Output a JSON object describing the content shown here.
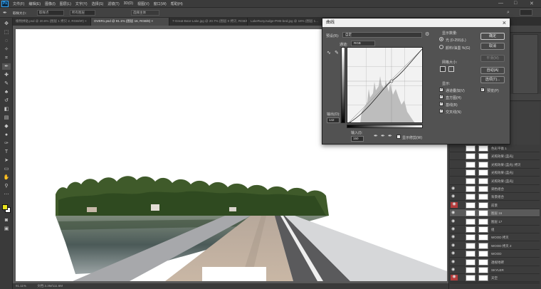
{
  "app": {
    "logo": "Ps"
  },
  "menu": [
    "文件(F)",
    "编辑(E)",
    "图像(I)",
    "图层(L)",
    "文字(Y)",
    "选择(S)",
    "滤镜(T)",
    "3D(D)",
    "视图(V)",
    "窗口(W)",
    "帮助(H)"
  ],
  "options_bar": {
    "tool_label": "取样大小:",
    "sample": "取样点",
    "all_layers": "所有图层",
    "select_subject": "选择主体"
  },
  "tabs": [
    {
      "label": "植物拼贴.psd @ 20.6% (图层 1 拷贝 2, RGB/8#) ×",
      "active": false
    },
    {
      "label": "OVER1.psd @ 91.1% (图层 16, RGB/8) ×",
      "active": true
    },
    {
      "label": "7-Great-Bear-Lake.jpg @ 20.7% (图层 0 拷贝, RGB/8) ×",
      "active": false
    },
    {
      "label": "LakeRunyJudge-PHB-bed.jpg @ 18% (图层 1...",
      "active": false
    }
  ],
  "status": {
    "zoom": "91.11%",
    "doc": "文档:3.3M/111.6M"
  },
  "curves": {
    "title": "曲线",
    "preset_label": "预设(R):",
    "preset_value": "自定",
    "channel_label": "通道:",
    "channel_value": "RGB",
    "output_label": "输出(O):",
    "output_value": "142",
    "input_label": "输入(I):",
    "input_value": "150",
    "show_clipping": "显示修剪(W)",
    "display_amount": "显示数量:",
    "light": "光 (0-255)(L)",
    "pigment": "颜料/油墨 %(G)",
    "grid_size": "网格大小:",
    "show": "显示:",
    "options": [
      "通道叠加(V)",
      "直方图(H)",
      "基线(B)",
      "交叉线(N)"
    ],
    "buttons": {
      "ok": "确定",
      "cancel": "取消",
      "smooth": "平滑(M)",
      "auto": "自动(A)",
      "options": "选项(T)..."
    },
    "preview": "预览(P)"
  },
  "layers": [
    {
      "name": "色彩平衡 1",
      "eye": false,
      "red": false,
      "sel": false
    },
    {
      "name": "光照效果 (蓝光)",
      "eye": false,
      "red": false,
      "sel": false
    },
    {
      "name": "光照效果 (蓝光) 拷贝",
      "eye": false,
      "red": false,
      "sel": false
    },
    {
      "name": "光照效果 (蓝光)",
      "eye": false,
      "red": false,
      "sel": false
    },
    {
      "name": "光照效果 (蓝光)",
      "eye": false,
      "red": false,
      "sel": false
    },
    {
      "name": "调色组合",
      "eye": true,
      "red": false,
      "sel": false
    },
    {
      "name": "背景组合",
      "eye": true,
      "red": false,
      "sel": false
    },
    {
      "name": "前景",
      "eye": false,
      "red": true,
      "sel": false
    },
    {
      "name": "图层 16",
      "eye": true,
      "red": false,
      "sel": true
    },
    {
      "name": "图层 17",
      "eye": true,
      "red": false,
      "sel": false
    },
    {
      "name": "组",
      "eye": true,
      "red": false,
      "sel": false
    },
    {
      "name": "WOOD 拷贝",
      "eye": true,
      "red": false,
      "sel": false
    },
    {
      "name": "WOOD 拷贝 2",
      "eye": true,
      "red": false,
      "sel": false
    },
    {
      "name": "WOOD",
      "eye": true,
      "red": false,
      "sel": false
    },
    {
      "name": "透视地砖",
      "eye": true,
      "red": false,
      "sel": false
    },
    {
      "name": "SKYLER",
      "eye": true,
      "red": false,
      "sel": false
    },
    {
      "name": "天空",
      "eye": false,
      "red": true,
      "sel": false
    }
  ],
  "colors": {
    "foreground": "#e9e31e",
    "background": "#ffffff",
    "accent": "#31a8ff"
  }
}
